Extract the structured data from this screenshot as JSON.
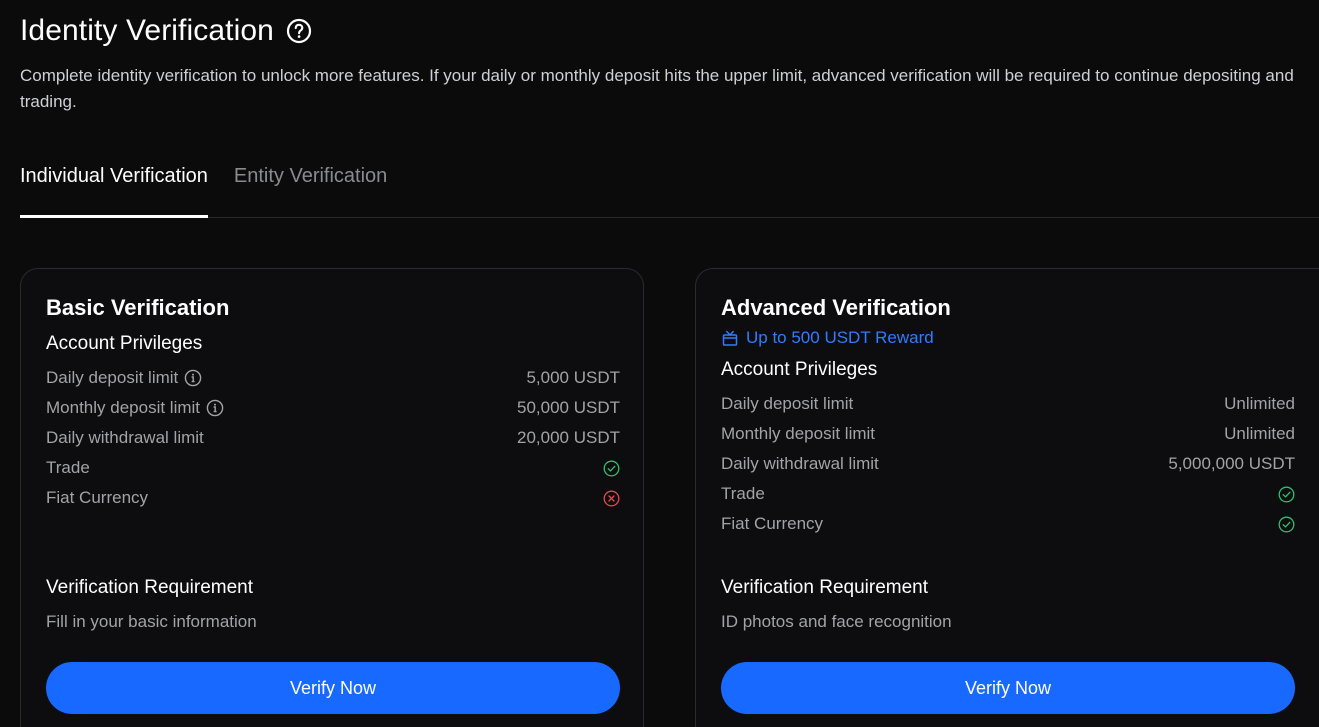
{
  "header": {
    "title": "Identity Verification",
    "description": "Complete identity verification to unlock more features. If your daily or monthly deposit hits the upper limit, advanced verification will be required to continue depositing and trading."
  },
  "tabs": [
    {
      "label": "Individual Verification",
      "active": true
    },
    {
      "label": "Entity Verification",
      "active": false
    }
  ],
  "basic": {
    "title": "Basic Verification",
    "privileges_title": "Account Privileges",
    "rows": [
      {
        "label": "Daily deposit limit",
        "value": "5,000 USDT"
      },
      {
        "label": "Monthly deposit limit",
        "value": "50,000 USDT"
      },
      {
        "label": "Daily withdrawal limit",
        "value": "20,000 USDT"
      },
      {
        "label": "Trade",
        "status": "yes"
      },
      {
        "label": "Fiat Currency",
        "status": "no"
      }
    ],
    "requirement_title": "Verification Requirement",
    "requirement_text": "Fill in your basic information",
    "button_label": "Verify Now"
  },
  "advanced": {
    "title": "Advanced Verification",
    "reward": "Up to 500 USDT Reward",
    "privileges_title": "Account Privileges",
    "rows": [
      {
        "label": "Daily deposit limit",
        "value": "Unlimited"
      },
      {
        "label": "Monthly deposit limit",
        "value": "Unlimited"
      },
      {
        "label": "Daily withdrawal limit",
        "value": "5,000,000 USDT"
      },
      {
        "label": "Trade",
        "status": "yes"
      },
      {
        "label": "Fiat Currency",
        "status": "yes"
      }
    ],
    "requirement_title": "Verification Requirement",
    "requirement_text": "ID photos and face recognition",
    "button_label": "Verify Now"
  },
  "colors": {
    "background": "#0b0b0c",
    "accent": "#1769ff",
    "reward": "#2f7cff",
    "success": "#2fbf71",
    "error": "#e5484d"
  },
  "icons": {
    "help": "question-circle-icon",
    "info": "info-circle-icon",
    "yes": "check-circle-icon",
    "no": "x-circle-icon",
    "reward": "gift-icon"
  }
}
